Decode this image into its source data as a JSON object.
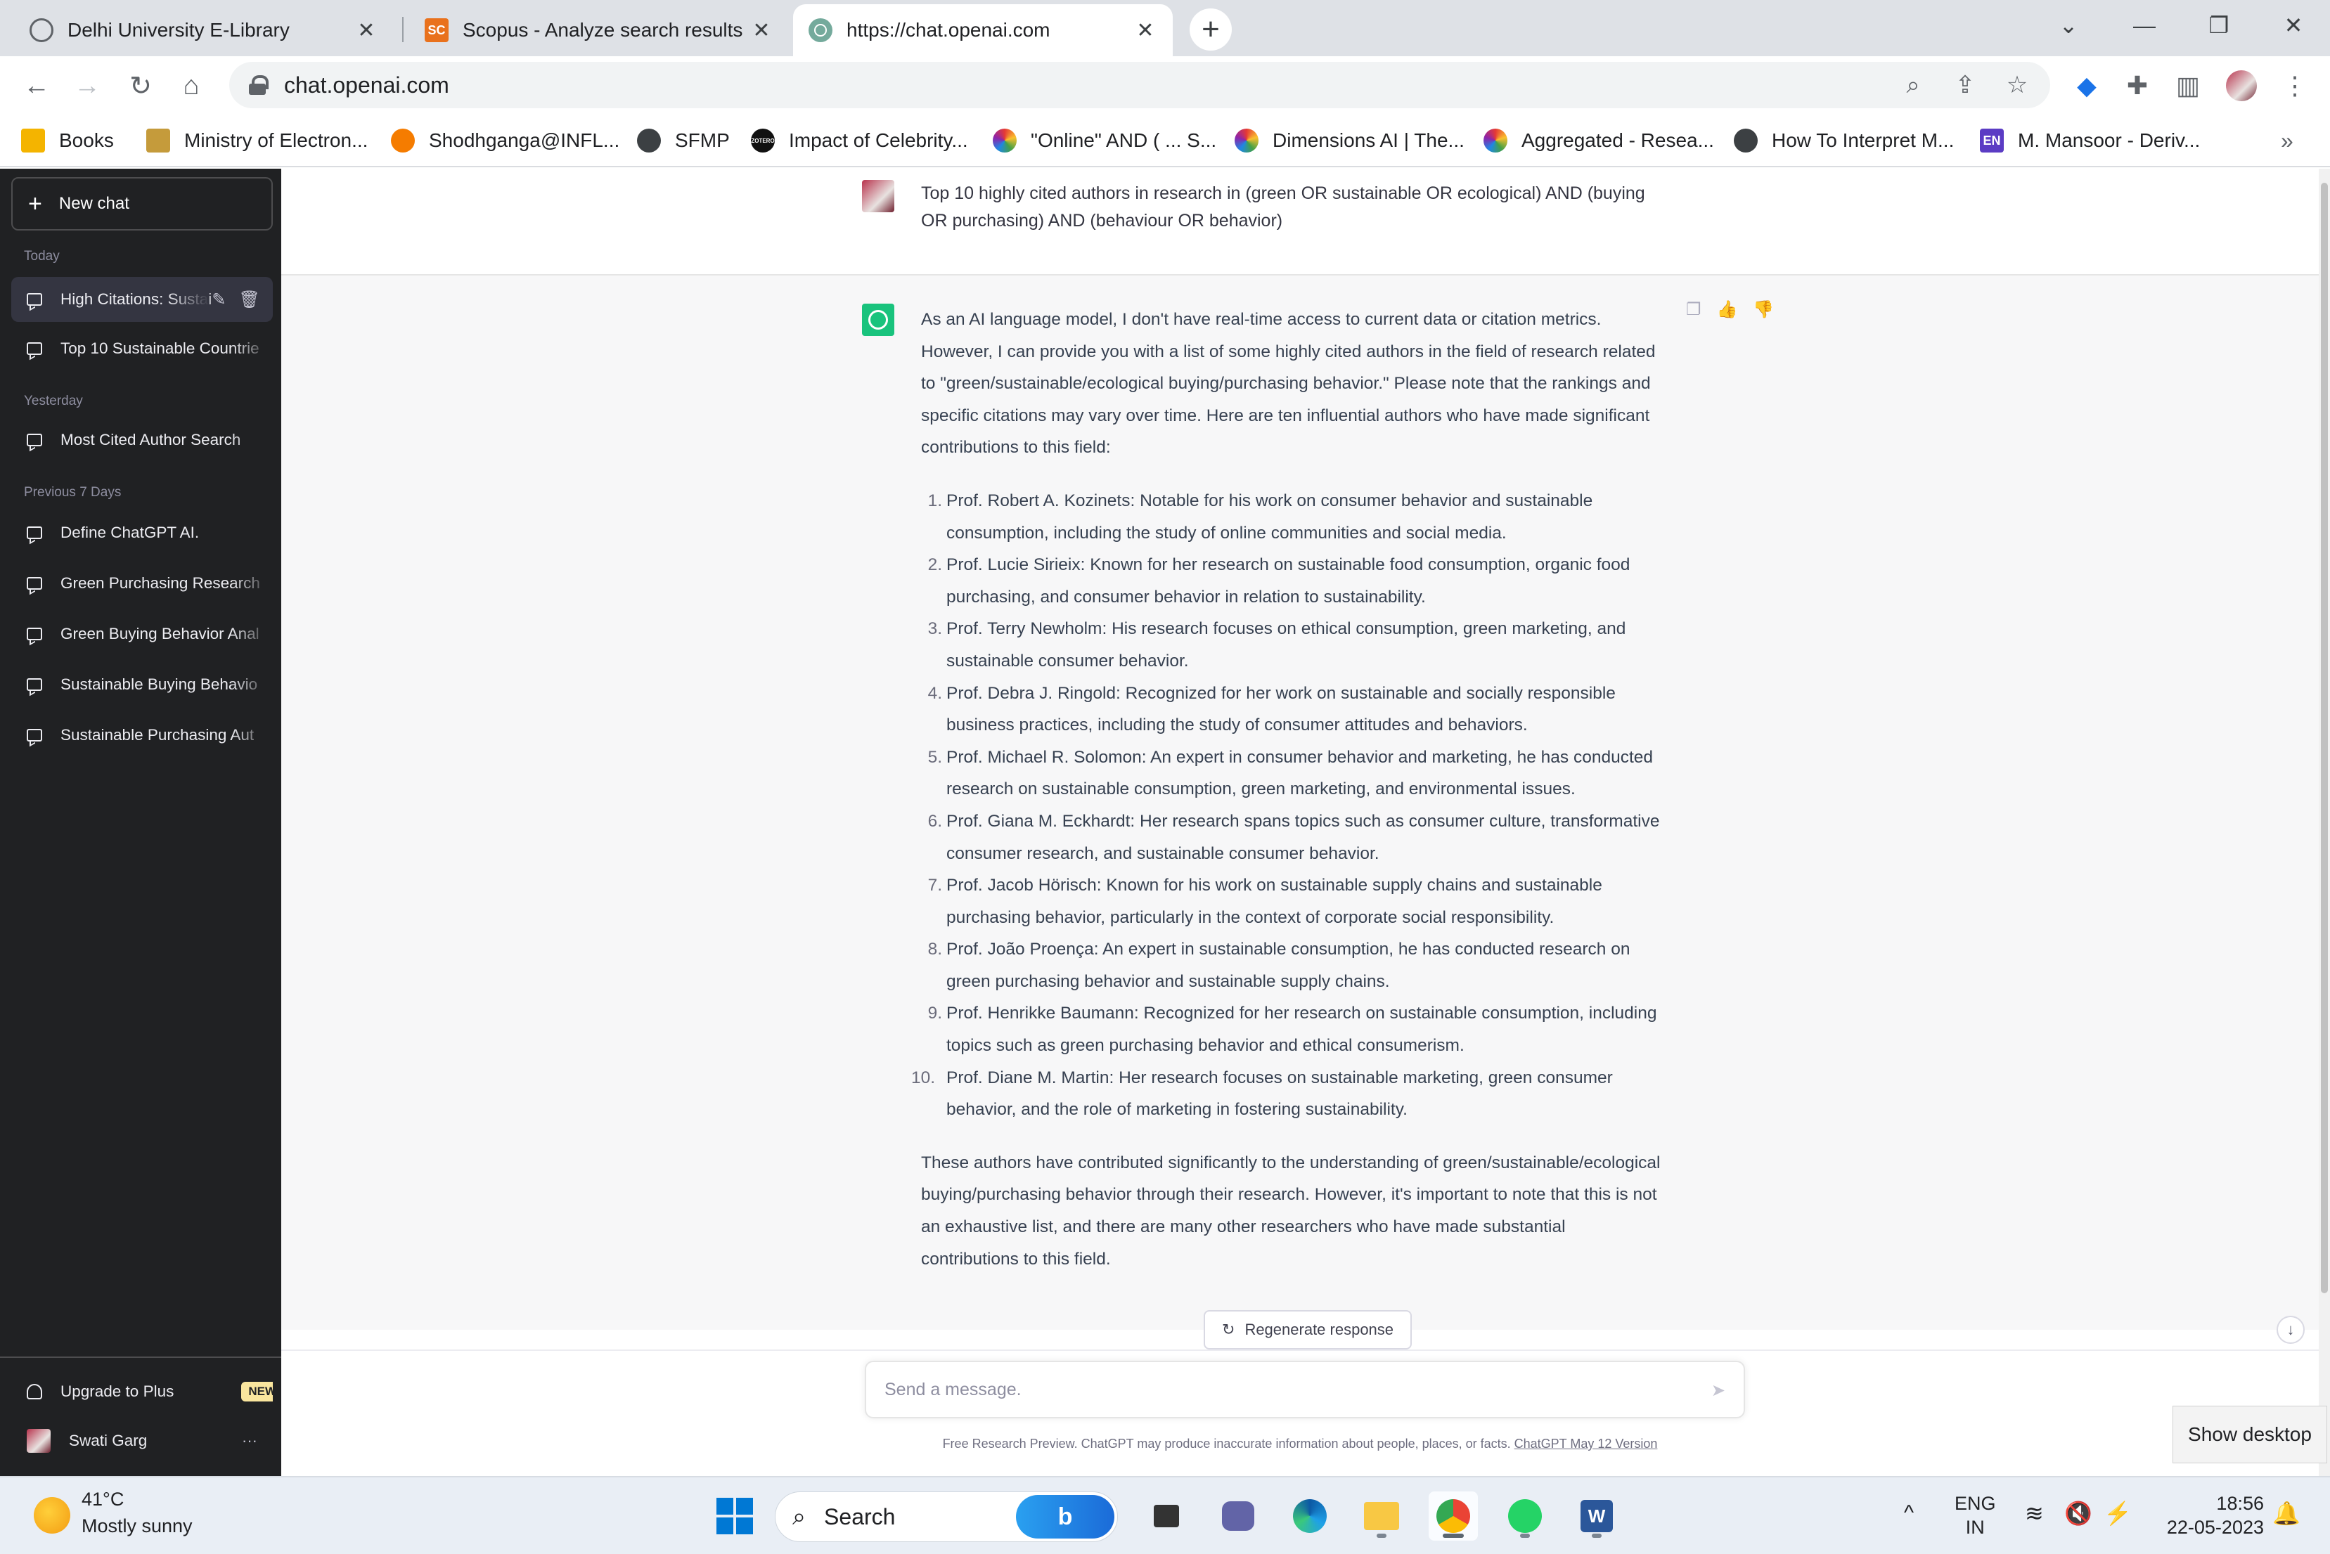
{
  "browser": {
    "tabs": [
      {
        "title": "Delhi University E-Library",
        "close": "✕",
        "favicon_color": "#5f6368"
      },
      {
        "title": "Scopus - Analyze search results",
        "close": "✕",
        "favicon_text": "SC",
        "favicon_color": "#e9711c"
      },
      {
        "title": "https://chat.openai.com",
        "close": "✕",
        "favicon_color": "#74aa9c"
      }
    ],
    "new_tab": "+",
    "url": "chat.openai.com",
    "bookmarks": [
      "Books",
      "Ministry of Electron...",
      "Shodhganga@INFL...",
      "SFMP",
      "Impact of Celebrity...",
      "\"Online\" AND ( ... S...",
      "Dimensions AI | The...",
      "Aggregated - Resea...",
      "How To Interpret M...",
      "M. Mansoor - Deriv..."
    ],
    "bookmark_badges": {
      "scopus_en": "EN",
      "impact": "ZOTERO"
    },
    "more_bookmarks": "»"
  },
  "sidebar": {
    "new_chat": "New chat",
    "sections": {
      "today": "Today",
      "yesterday": "Yesterday",
      "previous": "Previous 7 Days"
    },
    "today_items": [
      "High Citations: Sustai",
      "Top 10 Sustainable Countrie"
    ],
    "yesterday_items": [
      "Most Cited Author Search"
    ],
    "previous_items": [
      "Define ChatGPT AI.",
      "Green Purchasing Research",
      "Green Buying Behavior Anal",
      "Sustainable Buying Behavio",
      "Sustainable Purchasing Aut"
    ],
    "upgrade": "Upgrade to Plus",
    "new_badge": "NEW",
    "user_name": "Swati Garg",
    "user_menu": "···"
  },
  "chat": {
    "user_prompt": "Top 10 highly cited authors in research in (green  OR  sustainable  OR  ecological) AND (buying OR purchasing) AND (behaviour  OR  behavior)",
    "answer_intro": "As an AI language model, I don't have real-time access to current data or citation metrics. However, I can provide you with a list of some highly cited authors in the field of research related to \"green/sustainable/ecological buying/purchasing behavior.\" Please note that the rankings and specific citations may vary over time. Here are ten influential authors who have made significant contributions to this field:",
    "authors": [
      {
        "num": "1.",
        "text": "Prof. Robert A. Kozinets: Notable for his work on consumer behavior and sustainable consumption, including the study of online communities and social media."
      },
      {
        "num": "2.",
        "text": "Prof. Lucie Sirieix: Known for her research on sustainable food consumption, organic food purchasing, and consumer behavior in relation to sustainability."
      },
      {
        "num": "3.",
        "text": "Prof. Terry Newholm: His research focuses on ethical consumption, green marketing, and sustainable consumer behavior."
      },
      {
        "num": "4.",
        "text": "Prof. Debra J. Ringold: Recognized for her work on sustainable and socially responsible business practices, including the study of consumer attitudes and behaviors."
      },
      {
        "num": "5.",
        "text": "Prof. Michael R. Solomon: An expert in consumer behavior and marketing, he has conducted research on sustainable consumption, green marketing, and environmental issues."
      },
      {
        "num": "6.",
        "text": "Prof. Giana M. Eckhardt: Her research spans topics such as consumer culture, transformative consumer research, and sustainable consumer behavior."
      },
      {
        "num": "7.",
        "text": "Prof. Jacob Hörisch: Known for his work on sustainable supply chains and sustainable purchasing behavior, particularly in the context of corporate social responsibility."
      },
      {
        "num": "8.",
        "text": "Prof. João Proença: An expert in sustainable consumption, he has conducted research on green purchasing behavior and sustainable supply chains."
      },
      {
        "num": "9.",
        "text": "Prof. Henrikke Baumann: Recognized for her research on sustainable consumption, including topics such as green purchasing behavior and ethical consumerism."
      },
      {
        "num": "10.",
        "text": "Prof. Diane M. Martin: Her research focuses on sustainable marketing, green consumer behavior, and the role of marketing in fostering sustainability."
      }
    ],
    "answer_outro": "These authors have contributed significantly to the understanding of green/sustainable/ecological buying/purchasing behavior through their research. However, it's important to note that this is not an exhaustive list, and there are many other researchers who have made substantial contributions to this field.",
    "regenerate": "Regenerate response",
    "composer_placeholder": "Send a message.",
    "footnote": "Free Research Preview. ChatGPT may produce inaccurate information about people, places, or facts.",
    "footnote_link": "ChatGPT May 12 Version",
    "show_desktop": "Show desktop"
  },
  "taskbar": {
    "temperature": "41°C",
    "weather": "Mostly sunny",
    "search_label": "Search",
    "lang_top": "ENG",
    "lang_bottom": "IN",
    "time": "18:56",
    "date": "22-05-2023"
  },
  "colors": {
    "sidebar_bg": "#202123",
    "gpt_green": "#19c37d",
    "answer_bg": "#f7f7f8"
  }
}
